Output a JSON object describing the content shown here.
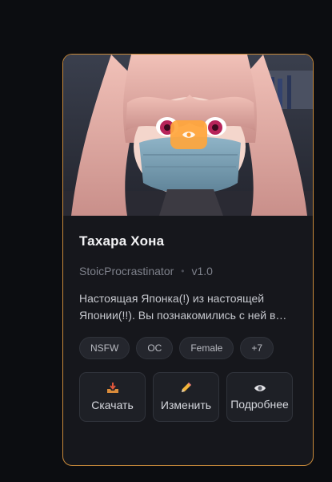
{
  "card": {
    "title": "Тахара Хона",
    "author": "StoicProcrastinator",
    "separator": "•",
    "version": "v1.0",
    "description": "Настоящая Японка(!) из настоящей Японии(!!). Вы познакомились с ней в…",
    "preview_icon": "eye-icon",
    "accent_color": "#c98a3a",
    "tags": [
      {
        "label": "NSFW"
      },
      {
        "label": "OC"
      },
      {
        "label": "Female"
      },
      {
        "label": "+7"
      }
    ],
    "actions": [
      {
        "label": "Скачать",
        "icon": "download-tray-icon"
      },
      {
        "label": "Изменить",
        "icon": "pencil-icon"
      },
      {
        "label": "Подробнее",
        "icon": "eye-icon"
      }
    ]
  }
}
